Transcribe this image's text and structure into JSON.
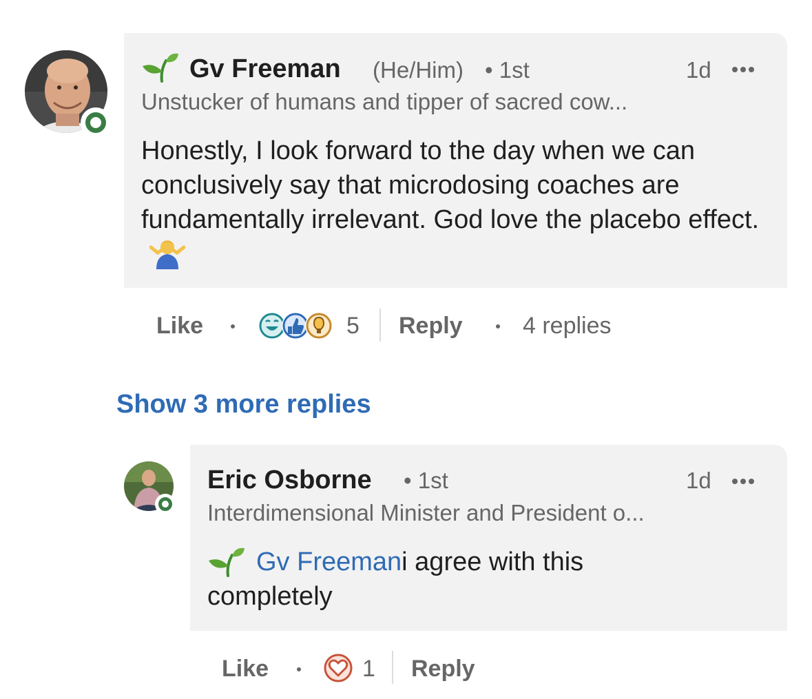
{
  "comment": {
    "author": "Gv Freeman",
    "pronouns": "(He/Him)",
    "degree": "• 1st",
    "headline": "Unstucker of humans and tipper of sacred cow...",
    "time": "1d",
    "body": "Honestly, I look forward to the day when we can conclusively say that microdosing coaches are fundamentally irrelevant. God love the placebo effect.",
    "actions": {
      "like": "Like",
      "reaction_count": "5",
      "reply": "Reply",
      "replies_count": "4 replies"
    }
  },
  "show_more": "Show 3 more replies",
  "reply": {
    "author": "Eric Osborne",
    "degree": "• 1st",
    "headline": "Interdimensional Minister and President o...",
    "time": "1d",
    "mention": "Gv Freeman",
    "body_line1": "i agree with this",
    "body_line2": "completely",
    "actions": {
      "like": "Like",
      "reaction_count": "1",
      "reply": "Reply"
    }
  },
  "colors": {
    "accent_link": "#2f6bb5",
    "online": "#3a7d44",
    "bubble": "#f2f2f2"
  },
  "icons": {
    "badge": "seedling-icon",
    "more": "more-options-icon",
    "reactions_main": [
      "funny-icon",
      "like-icon",
      "insightful-icon"
    ],
    "reactions_reply": [
      "love-icon"
    ],
    "emoji": "shrug-emoji-icon"
  }
}
